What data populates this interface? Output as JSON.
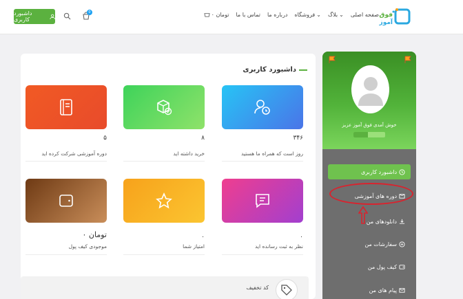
{
  "header": {
    "dashboard_button": "داشبورد کاربری",
    "cart_badge": "0",
    "nav": [
      {
        "label": "صفحه اصلی",
        "dropdown": false
      },
      {
        "label": "بلاگ",
        "dropdown": true
      },
      {
        "label": "فروشگاه",
        "dropdown": true
      },
      {
        "label": "درباره ما",
        "dropdown": false
      },
      {
        "label": "تماس با ما",
        "dropdown": false
      }
    ],
    "cart_total": "۰ تومان",
    "logo_text": "فوق آموز"
  },
  "sidebar": {
    "welcome": "خوش آمدی فوق آموز عزیز",
    "progress_fraction": 0.45,
    "items": [
      {
        "label": "داشبورد کاربری",
        "icon": "clock-icon",
        "active": true
      },
      {
        "label": "دوره های آموزشی",
        "icon": "courses-icon",
        "active": false
      },
      {
        "label": "دانلودهای من",
        "icon": "download-icon",
        "active": false
      },
      {
        "label": "سفارشات من",
        "icon": "orders-icon",
        "active": false
      },
      {
        "label": "کیف پول من",
        "icon": "wallet-icon",
        "active": false
      },
      {
        "label": "پیام های من",
        "icon": "mail-icon",
        "active": false
      }
    ]
  },
  "main": {
    "title": "داشبورد کاربری",
    "cards": [
      {
        "value": "۳۴۶",
        "label": "روز است که همراه ما هستید",
        "icon": "user-clock-icon",
        "color_from": "#27c4f5",
        "color_to": "#4a74e8"
      },
      {
        "value": "۸",
        "label": "خرید داشته اید",
        "icon": "box-check-icon",
        "color_from": "#3ed35a",
        "color_to": "#8fe26a"
      },
      {
        "value": "۵",
        "label": "دوره آموزشی شرکت کرده اید",
        "icon": "book-icon",
        "color_from": "#f15a24",
        "color_to": "#e84b2b"
      },
      {
        "value": "۰",
        "label": "نظر به ثبت رسانده اید",
        "icon": "comment-icon",
        "color_from": "#ef3e8f",
        "color_to": "#a23fcf"
      },
      {
        "value": "۰",
        "label": "امتیاز شما",
        "icon": "star-icon",
        "color_from": "#f7a21b",
        "color_to": "#fbc531"
      },
      {
        "value": "۰ تومان",
        "label": "موجودی کیف پول",
        "icon": "wallet-icon",
        "color_from": "#6e3a14",
        "color_to": "#c98e5a"
      }
    ],
    "coupon_title": "کد تخفیف"
  },
  "colors": {
    "brand_green": "#5bb13f",
    "annotation_red": "#d9232e"
  }
}
